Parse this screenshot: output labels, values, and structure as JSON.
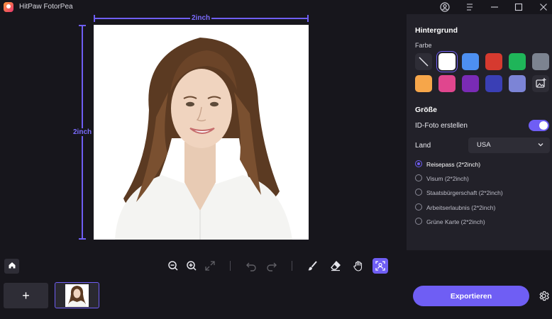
{
  "app": {
    "title": "HitPaw FotorPea"
  },
  "titlebar": {
    "icons": [
      "account-icon",
      "menu-icon",
      "minimize-icon",
      "maximize-icon",
      "close-icon"
    ]
  },
  "canvas": {
    "width_label": "2inch",
    "height_label": "2inch",
    "measure_color": "#6f5ef4"
  },
  "panel": {
    "background_title": "Hintergrund",
    "color_label": "Farbe",
    "swatches": [
      {
        "name": "none",
        "color": "#2e2d36"
      },
      {
        "name": "white",
        "color": "#ffffff",
        "selected": true
      },
      {
        "name": "blue",
        "color": "#4d8ff0"
      },
      {
        "name": "red",
        "color": "#d63a2f"
      },
      {
        "name": "green",
        "color": "#1fb559"
      },
      {
        "name": "gray",
        "color": "#7c8390"
      },
      {
        "name": "orange",
        "color": "#f6a64a"
      },
      {
        "name": "pink",
        "color": "#e0468e"
      },
      {
        "name": "purple",
        "color": "#7a2bb5"
      },
      {
        "name": "navy",
        "color": "#3a3fb5"
      },
      {
        "name": "lavender",
        "color": "#7c84d6"
      },
      {
        "name": "custom-image",
        "color": "#2e2d36"
      }
    ],
    "size_title": "Größe",
    "id_photo_label": "ID-Foto erstellen",
    "id_photo_enabled": true,
    "country_label": "Land",
    "country_value": "USA",
    "options": [
      {
        "label": "Reisepass (2*2inch)",
        "selected": true
      },
      {
        "label": "Visum (2*2inch)",
        "selected": false
      },
      {
        "label": "Staatsbürgerschaft (2*2inch)",
        "selected": false
      },
      {
        "label": "Arbeitserlaubnis (2*2inch)",
        "selected": false
      },
      {
        "label": "Grüne Karte (2*2inch)",
        "selected": false
      }
    ]
  },
  "toolbar": {
    "tools": [
      "home-icon",
      "zoom-out-icon",
      "zoom-in-icon",
      "fit-screen-icon",
      "undo-icon",
      "redo-icon",
      "brush-icon",
      "eraser-icon",
      "hand-icon",
      "portrait-select-icon"
    ]
  },
  "bottom": {
    "add_label": "+",
    "export_label": "Exportieren"
  },
  "colors": {
    "accent": "#6f5ef4",
    "panel": "#222129",
    "background": "#17161c"
  }
}
